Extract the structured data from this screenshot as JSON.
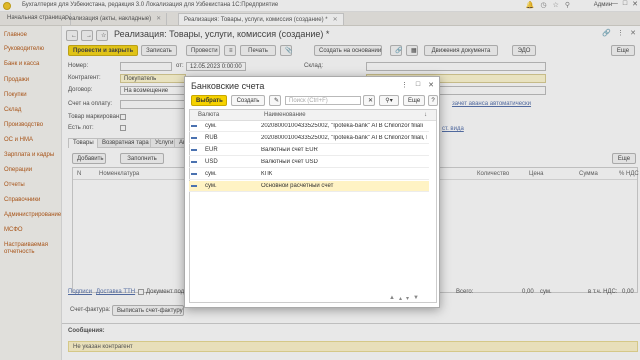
{
  "window": {
    "title": "Бухгалтерия для Узбекистана, редакция 3.0 Локализация для Узбекистана 1С:Предприятие",
    "user": "Админ",
    "icons": [
      "bell-icon",
      "history-icon",
      "star-icon",
      "search-icon"
    ]
  },
  "tabs": [
    {
      "label": "Начальная страница"
    },
    {
      "label": "Реализация (акты, накладные)"
    },
    {
      "label": "Реализация: Товары, услуги, комиссия (создание) *"
    }
  ],
  "sidebar": {
    "items": [
      "Главное",
      "Руководителю",
      "Банк и касса",
      "Продажи",
      "Покупки",
      "Склад",
      "Производство",
      "ОС и НМА",
      "Зарплата и кадры",
      "Операции",
      "Отчеты",
      "Справочники",
      "Администрирование",
      "МСФО",
      "Настраиваемая отчетность"
    ]
  },
  "document": {
    "title": "Реализация: Товары, услуги, комиссия (создание) *",
    "toolbar": {
      "post_close": "Провести и закрыть",
      "save": "Записать",
      "post": "Провести",
      "print": "Печать",
      "create_based": "Создать на основании",
      "doc_movements": "Движения документа",
      "edo": "ЭДО",
      "more": "Еще"
    },
    "fields": {
      "number_label": "Номер:",
      "from_label": "от:",
      "date_value": "12.05.2023  0:00:00",
      "warehouse_label": "Склад:",
      "counterparty_label": "Контрагент:",
      "counterparty_value": "Покупатель",
      "contract_label": "Договор:",
      "contract_value": "На возмещение",
      "invoice_label": "Счет на оплату:",
      "marked_label": "Товар маркирован:",
      "posted_label": "Есть лот:",
      "right_link1": "зачет аванса автоматически",
      "right_link2": "ст. вида"
    },
    "subtabs": [
      "Товары",
      "Возвратная тара",
      "Услуги",
      "Аге"
    ],
    "table_toolbar": {
      "add": "Добавить",
      "fill": "Заполнить",
      "more": "Еще"
    },
    "columns": [
      "N",
      "Номенклатура",
      "Количество",
      "Цена",
      "Сумма",
      "% НДС"
    ],
    "footer": {
      "links": [
        "Подписи",
        "Доставка ТТН",
        "Документ подпи"
      ],
      "total_label": "Всего:",
      "total_value": "0,00",
      "currency": "сум.",
      "vat_label": "в т.ч. НДС:",
      "vat_value": "0,00",
      "invoice_tab": "Счет-фактура:",
      "invoice_button": "Выписать счет-фактуру"
    }
  },
  "messages": {
    "title": "Сообщения:",
    "items": [
      "Не указан контрагент"
    ]
  },
  "dialog": {
    "title": "Банковские счета",
    "select": "Выбрать",
    "create": "Создать",
    "search_placeholder": "Поиск (Ctrl+F)",
    "more": "Еще",
    "help": "?",
    "col_currency": "Валюта",
    "col_name": "Наименование",
    "rows": [
      {
        "currency": "сум.",
        "name": "20208000100433525002, \"Ipoteka-bank\" ATB Chilonzor filiali"
      },
      {
        "currency": "RUB",
        "name": "20208000100433525002, \"Ipoteka-bank\" ATB Chilonzor filiali, R..."
      },
      {
        "currency": "EUR",
        "name": "Валютный счет EUR"
      },
      {
        "currency": "USD",
        "name": "Валютный счет USD"
      },
      {
        "currency": "сум.",
        "name": "КПК"
      },
      {
        "currency": "сум.",
        "name": "Основной расчетный счет",
        "selected": true
      }
    ]
  },
  "colors": {
    "accent": "#f6d200",
    "link": "#4664a5",
    "sidebar_text": "#b04a00",
    "selected_row": "#fff3c4"
  }
}
